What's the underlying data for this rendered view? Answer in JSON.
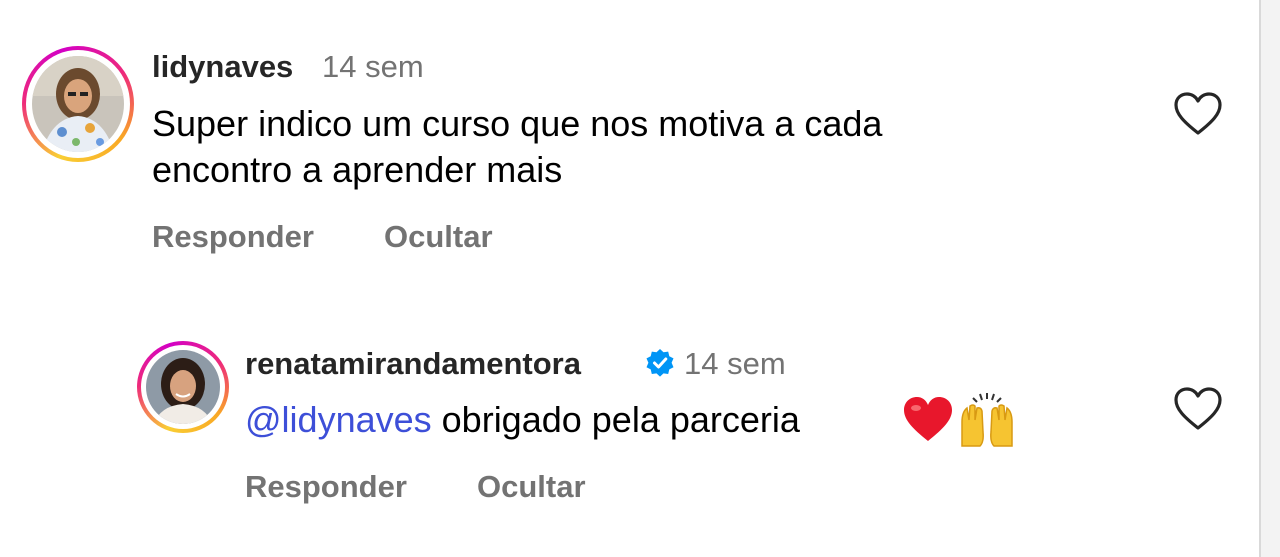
{
  "comments": [
    {
      "username": "lidynaves",
      "time": "14 sem",
      "text_line1": "Super indico um curso que nos motiva a cada",
      "text_line2": "encontro a aprender mais",
      "reply_label": "Responder",
      "hide_label": "Ocultar"
    },
    {
      "username": "renatamirandamentora",
      "verified": true,
      "time": "14 sem",
      "mention": "@lidynaves",
      "text": "obrigado pela parceria",
      "emojis": [
        "red-heart",
        "raising-hands"
      ],
      "reply_label": "Responder",
      "hide_label": "Ocultar"
    }
  ],
  "colors": {
    "mention": "#3d4fd8",
    "verified_badge": "#0095f6",
    "meta_text": "#737373",
    "heart_emoji": "#e8172c"
  }
}
